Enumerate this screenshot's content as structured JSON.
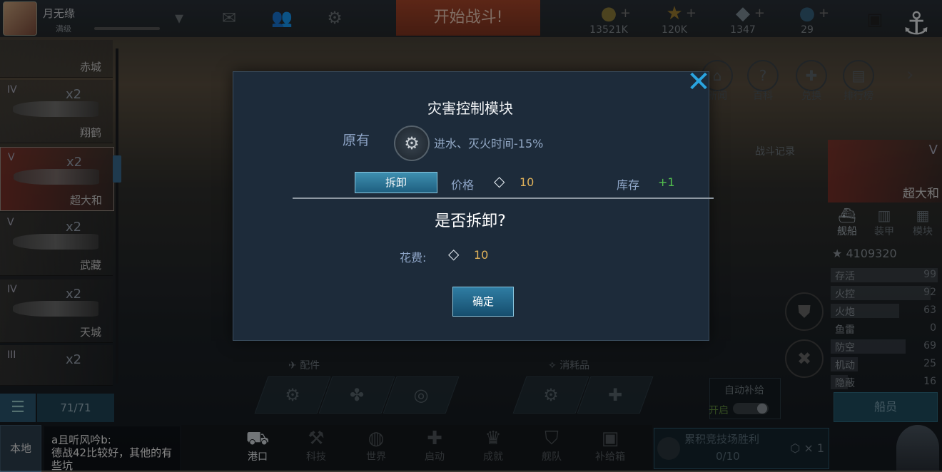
{
  "top": {
    "player_name": "月无缘",
    "player_level": "满级",
    "battle_button": "开始战斗!",
    "resources": [
      {
        "icon": "gold-icon",
        "value": "13521K"
      },
      {
        "icon": "star-icon",
        "value": "120K"
      },
      {
        "icon": "diamond-icon",
        "value": "1347"
      },
      {
        "icon": "blue-gem-icon",
        "value": "29"
      }
    ]
  },
  "side_menu": [
    {
      "icon": "news-icon",
      "label": "新闻"
    },
    {
      "icon": "encyclopedia-icon",
      "label": "百科"
    },
    {
      "icon": "exchange-icon",
      "label": "兑换"
    },
    {
      "icon": "ranking-icon",
      "label": "排行榜"
    }
  ],
  "fleet": {
    "items": [
      {
        "tier": "",
        "count": "",
        "name": "赤城"
      },
      {
        "tier": "IV",
        "count": "x2",
        "name": "翔鹤"
      },
      {
        "tier": "V",
        "count": "x2",
        "name": "超大和"
      },
      {
        "tier": "V",
        "count": "x2",
        "name": "武藏"
      },
      {
        "tier": "IV",
        "count": "x2",
        "name": "天城"
      },
      {
        "tier": "III",
        "count": "x2",
        "name": ""
      }
    ],
    "count_label": "71/71"
  },
  "chat": {
    "channel": "本地",
    "message": "a且听风吟b:\n德战42比较好，其他的有些坑"
  },
  "bottom_nav": [
    {
      "icon": "port-icon",
      "label": "港口",
      "active": true
    },
    {
      "icon": "tech-icon",
      "label": "科技"
    },
    {
      "icon": "world-icon",
      "label": "世界"
    },
    {
      "icon": "launch-icon",
      "label": "启动"
    },
    {
      "icon": "achievement-icon",
      "label": "成就"
    },
    {
      "icon": "fleet-icon",
      "label": "舰队"
    },
    {
      "icon": "supply-box-icon",
      "label": "补给箱"
    }
  ],
  "arena": {
    "title": "累积竞技场胜利",
    "progress": "0/10",
    "multiplier": "× 1"
  },
  "equipment": {
    "parts_label": "配件",
    "consumables_label": "消耗品",
    "auto_supply_label": "自动补给",
    "auto_supply_state": "开启"
  },
  "right_panel": {
    "ship_name": "超大和",
    "ship_tier": "V",
    "battle_record": "战斗记录",
    "tabs": [
      {
        "icon": "ship-icon",
        "label": "舰船"
      },
      {
        "icon": "armor-icon",
        "label": "装甲"
      },
      {
        "icon": "module-icon",
        "label": "模块"
      }
    ],
    "power": "4109320",
    "stats": [
      {
        "label": "存活",
        "value": "99",
        "pct": 0.99
      },
      {
        "label": "火控",
        "value": "92",
        "pct": 0.92
      },
      {
        "label": "火炮",
        "value": "63",
        "pct": 0.63
      },
      {
        "label": "鱼雷",
        "value": "0",
        "pct": 0.0
      },
      {
        "label": "防空",
        "value": "69",
        "pct": 0.69
      },
      {
        "label": "机动",
        "value": "25",
        "pct": 0.25
      },
      {
        "label": "隐蔽",
        "value": "16",
        "pct": 0.16
      }
    ],
    "crew_button": "船员"
  },
  "modal": {
    "title": "灾害控制模块",
    "original_label": "原有",
    "module_desc": "进水、灭火时间-15%",
    "remove_button": "拆卸",
    "price_label": "价格",
    "price_value": "10",
    "stock_label": "库存",
    "stock_value": "+1",
    "question": "是否拆卸?",
    "cost_label": "花费:",
    "cost_value": "10",
    "confirm_button": "确定"
  }
}
